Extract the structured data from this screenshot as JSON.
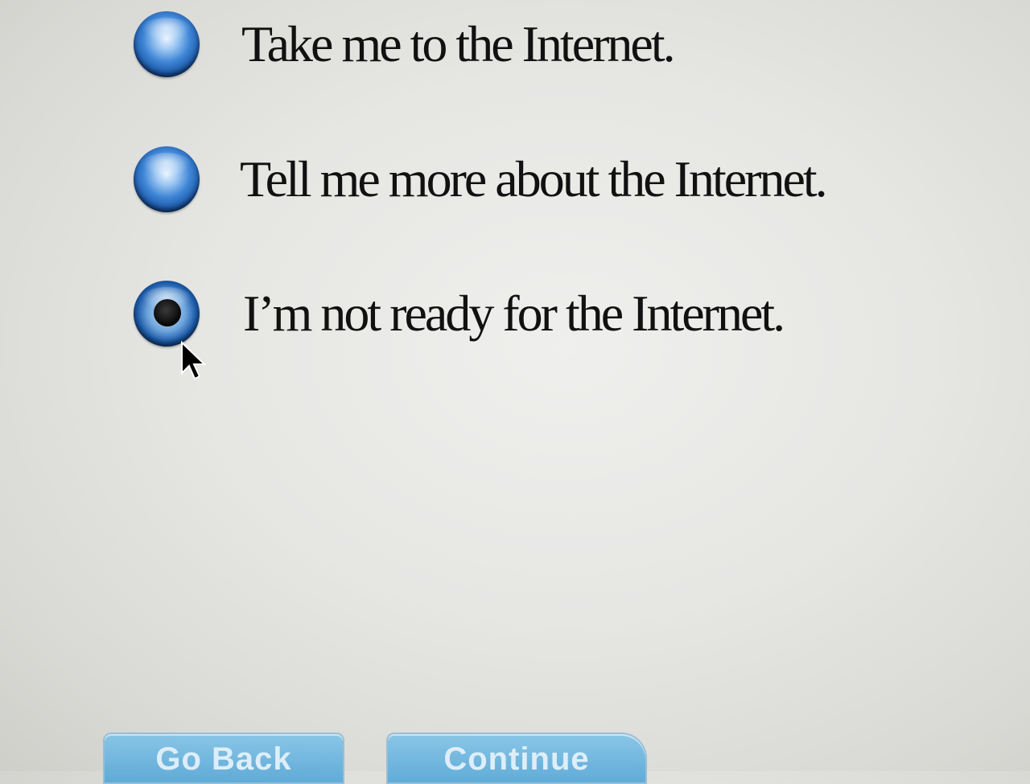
{
  "options": [
    {
      "label": "Take me to the Internet.",
      "selected": false
    },
    {
      "label": "Tell me more about the Internet.",
      "selected": false
    },
    {
      "label": "I’m not ready for the Internet.",
      "selected": true
    }
  ],
  "buttons": {
    "back_label": "Go Back",
    "continue_label": "Continue"
  },
  "icons": {
    "radio": "radio-button-icon",
    "cursor": "arrow-cursor-icon"
  },
  "colors": {
    "radio_blue": "#1a56a6",
    "button_blue": "#4aa3d8",
    "text": "#111111"
  }
}
